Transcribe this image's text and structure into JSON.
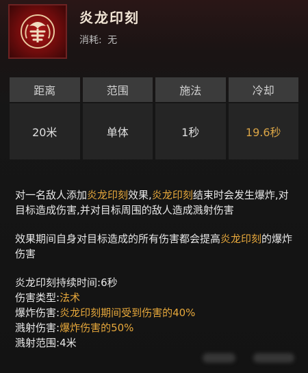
{
  "skill": {
    "name": "炎龙印刻",
    "cost_label": "消耗:",
    "cost_value": "无",
    "icon": "dragon-seal-icon"
  },
  "stats": {
    "headers": [
      "距离",
      "范围",
      "施法",
      "冷却"
    ],
    "values": [
      "20米",
      "单体",
      "1秒",
      "19.6秒"
    ]
  },
  "description": {
    "p1": [
      {
        "text": "对一名敌人添加",
        "hl": false
      },
      {
        "text": "炎龙印刻",
        "hl": true
      },
      {
        "text": "效果,",
        "hl": false
      },
      {
        "text": "炎龙印刻",
        "hl": true
      },
      {
        "text": "结束时会发生爆炸,对目标造成伤害,并对目标周围的敌人造成溅射伤害",
        "hl": false
      }
    ],
    "p2": [
      {
        "text": "效果期间自身对目标造成的所有伤害都会提高",
        "hl": false
      },
      {
        "text": "炎龙印刻",
        "hl": true
      },
      {
        "text": "的爆炸伤害",
        "hl": false
      }
    ],
    "attributes": [
      {
        "key": "炎龙印刻持续时间:",
        "value": "6秒",
        "value_hl": false
      },
      {
        "key": "伤害类型:",
        "value": "法术",
        "value_hl": true
      },
      {
        "key": "爆炸伤害:",
        "value": "炎龙印刻期间受到伤害的40%",
        "value_hl": true
      },
      {
        "key": "溅射伤害:",
        "value": "爆炸伤害的50%",
        "value_hl": true
      },
      {
        "key": "溅射范围:",
        "value": "4米",
        "value_hl": false
      }
    ]
  },
  "colors": {
    "highlight": "#e7a83b",
    "cooldown": "#d9a446",
    "header_bg": "#3b3b3b",
    "value_bg": "#252525",
    "icon_red": "#b01818"
  }
}
